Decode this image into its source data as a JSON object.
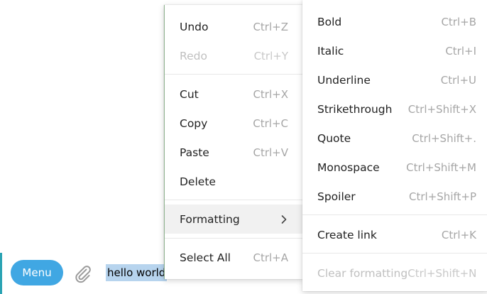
{
  "composer": {
    "menu_label": "Menu",
    "text": "hello world"
  },
  "icons": {
    "attach": "paperclip-icon",
    "submenu": "chevron-right-icon"
  },
  "colors": {
    "accent": "#40a7e3",
    "selection": "#b7d4ee"
  },
  "context_menu": {
    "undo": {
      "label": "Undo",
      "shortcut": "Ctrl+Z"
    },
    "redo": {
      "label": "Redo",
      "shortcut": "Ctrl+Y"
    },
    "cut": {
      "label": "Cut",
      "shortcut": "Ctrl+X"
    },
    "copy": {
      "label": "Copy",
      "shortcut": "Ctrl+C"
    },
    "paste": {
      "label": "Paste",
      "shortcut": "Ctrl+V"
    },
    "delete": {
      "label": "Delete"
    },
    "formatting": {
      "label": "Formatting"
    },
    "select_all": {
      "label": "Select All",
      "shortcut": "Ctrl+A"
    }
  },
  "formatting_menu": {
    "bold": {
      "label": "Bold",
      "shortcut": "Ctrl+B"
    },
    "italic": {
      "label": "Italic",
      "shortcut": "Ctrl+I"
    },
    "underline": {
      "label": "Underline",
      "shortcut": "Ctrl+U"
    },
    "strikethrough": {
      "label": "Strikethrough",
      "shortcut": "Ctrl+Shift+X"
    },
    "quote": {
      "label": "Quote",
      "shortcut": "Ctrl+Shift+."
    },
    "monospace": {
      "label": "Monospace",
      "shortcut": "Ctrl+Shift+M"
    },
    "spoiler": {
      "label": "Spoiler",
      "shortcut": "Ctrl+Shift+P"
    },
    "create_link": {
      "label": "Create link",
      "shortcut": "Ctrl+K"
    },
    "clear_formatting": {
      "label": "Clear formatting",
      "shortcut": "Ctrl+Shift+N"
    }
  }
}
